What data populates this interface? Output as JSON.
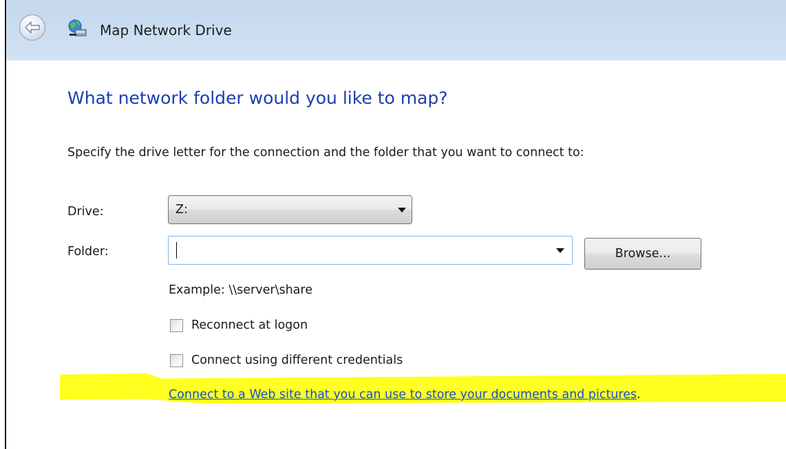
{
  "window": {
    "title": "Map Network Drive"
  },
  "main": {
    "heading": "What network folder would you like to map?",
    "instructions": "Specify the drive letter for the connection and the folder that you want to connect to:",
    "drive": {
      "label": "Drive:",
      "selected": "Z:"
    },
    "folder": {
      "label": "Folder:",
      "value": "",
      "placeholder": ""
    },
    "browse_button": "Browse...",
    "example": "Example: \\\\server\\share",
    "reconnect_checkbox": {
      "label": "Reconnect at logon",
      "checked": false
    },
    "credentials_checkbox": {
      "label": "Connect using different credentials",
      "checked": false
    },
    "web_link": {
      "text": "Connect to a Web site that you can use to store your documents and pictures",
      "suffix": "."
    }
  },
  "icons": {
    "back": "back-arrow-icon",
    "title": "network-drive-icon"
  },
  "colors": {
    "titlebar": "#c9dcf0",
    "heading": "#1a3fb0",
    "link": "#1551c9",
    "highlight": "#ffff20"
  }
}
